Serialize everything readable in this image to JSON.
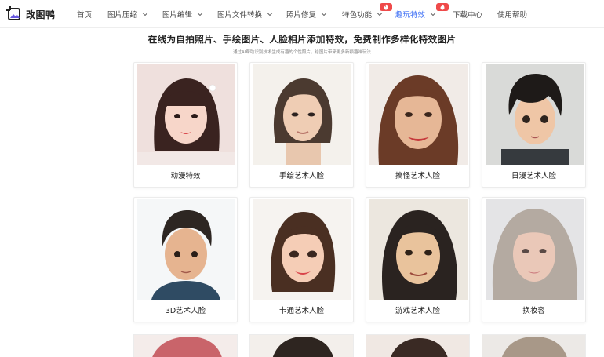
{
  "brand": {
    "name": "改图鸭"
  },
  "nav": {
    "items": [
      {
        "label": "首页",
        "has_chevron": false
      },
      {
        "label": "图片压缩",
        "has_chevron": true
      },
      {
        "label": "图片编辑",
        "has_chevron": true
      },
      {
        "label": "图片文件转换",
        "has_chevron": true
      },
      {
        "label": "照片修复",
        "has_chevron": true
      },
      {
        "label": "特色功能",
        "has_chevron": true
      },
      {
        "label": "趣玩特效",
        "has_chevron": true,
        "active": true
      },
      {
        "label": "下载中心",
        "has_chevron": false
      },
      {
        "label": "使用帮助",
        "has_chevron": false
      }
    ],
    "badges": [
      "hot",
      "hot"
    ],
    "accent_color": "#3d6ff5",
    "badge_color": "#ef4a4a"
  },
  "header": {
    "title": "在线为自拍照片、手绘图片、人脸相片添加特效，免费制作多样化特效图片",
    "subtitle": "通过AI帮助识别技术生成有趣的个性照片，给图片带来更多新颖趣味玩法"
  },
  "effects": [
    {
      "label": "动漫特效"
    },
    {
      "label": "手绘艺术人脸"
    },
    {
      "label": "搞怪艺术人脸"
    },
    {
      "label": "日漫艺术人脸"
    },
    {
      "label": "3D艺术人脸"
    },
    {
      "label": "卡通艺术人脸"
    },
    {
      "label": "游戏艺术人脸"
    },
    {
      "label": "换妆容"
    }
  ]
}
